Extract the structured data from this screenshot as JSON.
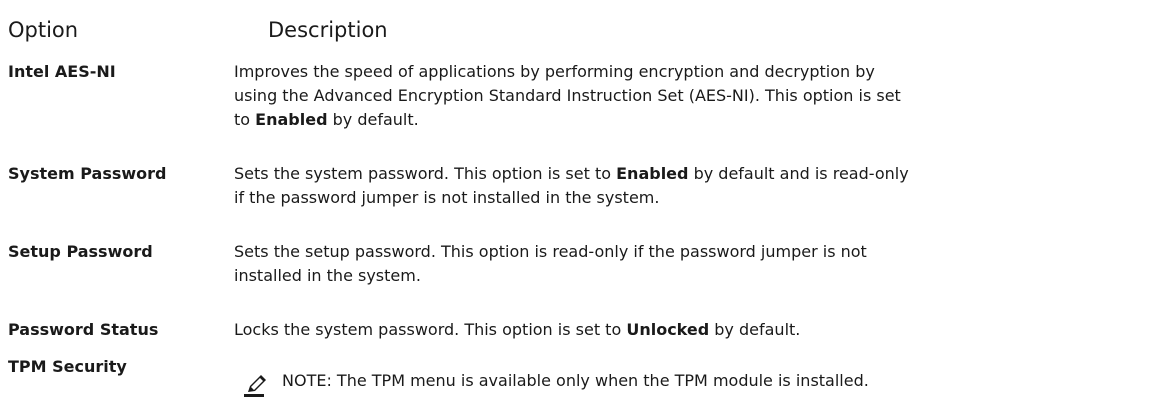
{
  "header": {
    "option_label": "Option",
    "description_label": "Description"
  },
  "rows": [
    {
      "option": "Intel AES-NI",
      "description": {
        "lines": [
          "Improves the speed of applications by performing encryption and decryption by",
          "using the Advanced Encryption Standard Instruction Set (AES-NI). This option is set"
        ],
        "line3_prefix": "to ",
        "line3_bold": "Enabled",
        "line3_suffix": " by default."
      }
    },
    {
      "option": "System Password",
      "description": {
        "prefix": "Sets the system password. This option is set to ",
        "bold": "Enabled",
        "suffix": " by default and is read-only",
        "line2": "if the password jumper is not installed in the system."
      }
    },
    {
      "option": "Setup Password",
      "description": {
        "line1": "Sets the setup password. This option is read-only if the password jumper is not",
        "line2": "installed in the system."
      }
    },
    {
      "option": "Password Status",
      "description": {
        "prefix": "Locks the system password. This option is set to ",
        "bold": "Unlocked",
        "suffix": " by default."
      }
    },
    {
      "option": "TPM Security",
      "note": {
        "label": "NOTE:",
        "text": " The TPM menu is available only when the TPM module is installed.",
        "icon": "pencil-note-icon"
      }
    }
  ]
}
